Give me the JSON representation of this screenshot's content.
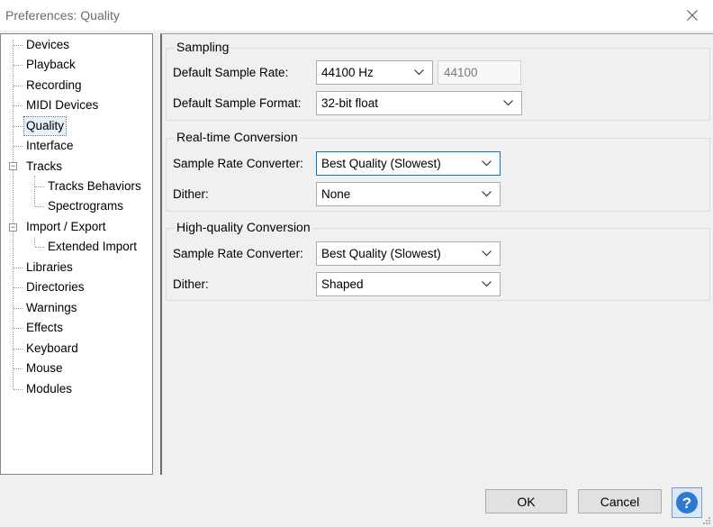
{
  "window": {
    "title": "Preferences: Quality",
    "close_icon": "close-icon"
  },
  "tree": {
    "items": [
      {
        "label": "Devices"
      },
      {
        "label": "Playback"
      },
      {
        "label": "Recording"
      },
      {
        "label": "MIDI Devices"
      },
      {
        "label": "Quality",
        "selected": true
      },
      {
        "label": "Interface"
      },
      {
        "label": "Tracks",
        "expander": "⊟"
      },
      {
        "label": "Tracks Behaviors"
      },
      {
        "label": "Spectrograms"
      },
      {
        "label": "Import / Export",
        "expander": "⊟"
      },
      {
        "label": "Extended Import"
      },
      {
        "label": "Libraries"
      },
      {
        "label": "Directories"
      },
      {
        "label": "Warnings"
      },
      {
        "label": "Effects"
      },
      {
        "label": "Keyboard"
      },
      {
        "label": "Mouse"
      },
      {
        "label": "Modules"
      }
    ]
  },
  "sampling": {
    "title": "Sampling",
    "rate_label": "Default Sample Rate:",
    "rate_value": "44100 Hz",
    "rate_text": "44100",
    "format_label": "Default Sample Format:",
    "format_value": "32-bit float"
  },
  "realtime": {
    "title": "Real-time Conversion",
    "converter_label": "Sample Rate Converter:",
    "converter_value": "Best Quality (Slowest)",
    "dither_label": "Dither:",
    "dither_value": "None"
  },
  "highquality": {
    "title": "High-quality Conversion",
    "converter_label": "Sample Rate Converter:",
    "converter_value": "Best Quality (Slowest)",
    "dither_label": "Dither:",
    "dither_value": "Shaped"
  },
  "buttons": {
    "ok": "OK",
    "cancel": "Cancel",
    "help_icon": "help-icon"
  },
  "colors": {
    "accent": "#0078d7",
    "help_blue": "#2f7ad1"
  }
}
